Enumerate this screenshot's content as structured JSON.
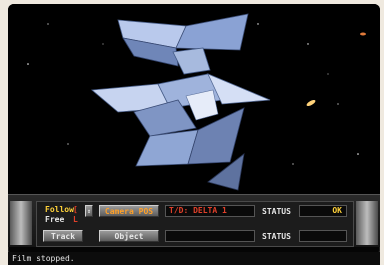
{
  "console": {
    "follow_label": "Follow",
    "free_label": "Free",
    "track_button": "Track",
    "object_button": "Object",
    "camera_pos_button": "Camera POS",
    "target_label": "T/D: DELTA 1",
    "status1_label": "STATUS",
    "status1_value": "OK",
    "status2_label": "STATUS",
    "status2_value": ""
  },
  "statusbar": {
    "message": "Film stopped."
  },
  "colors": {
    "accent_red": "#e0402a",
    "accent_yellow": "#ffd23a",
    "accent_orange": "#ffa028",
    "ship_blue": "#8aa8d8"
  }
}
